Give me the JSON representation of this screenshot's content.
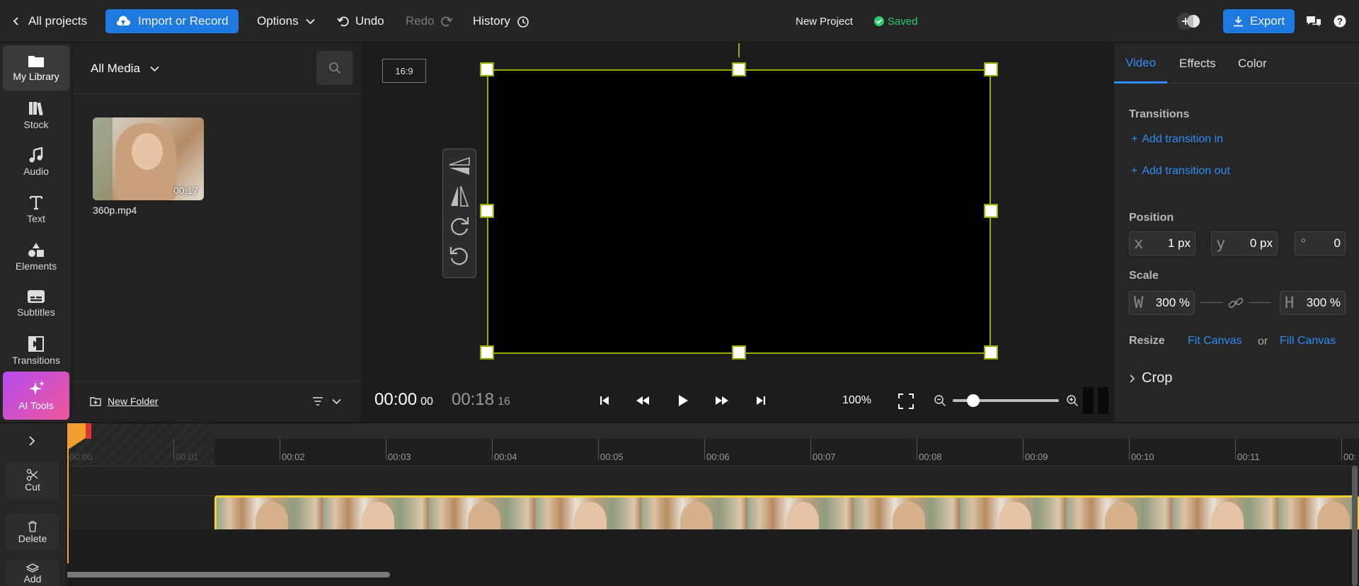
{
  "topbar": {
    "back_label": "All projects",
    "import_label": "Import or Record",
    "options_label": "Options",
    "undo_label": "Undo",
    "redo_label": "Redo",
    "history_label": "History",
    "project_name": "New Project",
    "saved_label": "Saved",
    "export_label": "Export"
  },
  "leftnav": {
    "items": [
      {
        "label": "My Library",
        "icon": "folder-icon"
      },
      {
        "label": "Stock",
        "icon": "books-icon"
      },
      {
        "label": "Audio",
        "icon": "music-note-icon"
      },
      {
        "label": "Text",
        "icon": "text-icon"
      },
      {
        "label": "Elements",
        "icon": "shapes-icon"
      },
      {
        "label": "Subtitles",
        "icon": "subtitles-icon"
      },
      {
        "label": "Transitions",
        "icon": "transitions-icon"
      },
      {
        "label": "AI Tools",
        "icon": "sparkle-icon"
      }
    ]
  },
  "media": {
    "filter_label": "All Media",
    "items": [
      {
        "name": "360p.mp4",
        "duration": "00:17"
      }
    ],
    "new_folder_label": "New Folder"
  },
  "preview": {
    "aspect_label": "16:9",
    "current_time": "00:00",
    "current_frames": "00",
    "total_time": "00:18",
    "total_frames": "16",
    "zoom_label": "100%",
    "zoom_level": 0.15
  },
  "props": {
    "tabs": [
      "Video",
      "Effects",
      "Color"
    ],
    "active_tab": "Video",
    "transitions_title": "Transitions",
    "add_transition_in": "Add transition in",
    "add_transition_out": "Add transition out",
    "position_title": "Position",
    "pos_x_label": "x",
    "pos_x": "1 px",
    "pos_y_label": "y",
    "pos_y": "0 px",
    "rotation_label": "°",
    "rotation": "0",
    "scale_title": "Scale",
    "scale_w_label": "W",
    "scale_w": "300 %",
    "scale_h_label": "H",
    "scale_h": "300 %",
    "resize_title": "Resize",
    "fit_canvas": "Fit Canvas",
    "or_label": "or",
    "fill_canvas": "Fill Canvas",
    "crop_title": "Crop"
  },
  "timeline": {
    "tools": [
      {
        "label": "Cut",
        "icon": "scissors-icon"
      },
      {
        "label": "Delete",
        "icon": "trash-icon"
      },
      {
        "label": "Add",
        "icon": "layers-icon"
      }
    ],
    "ticks": [
      "00:00",
      "00:01",
      "00:02",
      "00:03",
      "00:04",
      "00:05",
      "00:06",
      "00:07",
      "00:08",
      "00:09",
      "00:10",
      "00:11",
      "00:"
    ]
  },
  "colors": {
    "accent_blue": "#1f7ae0",
    "selection_yellow": "#9aa800",
    "saved_green": "#2ecc71",
    "clip_border": "#f2d22e",
    "playhead_orange": "#f0a030"
  }
}
